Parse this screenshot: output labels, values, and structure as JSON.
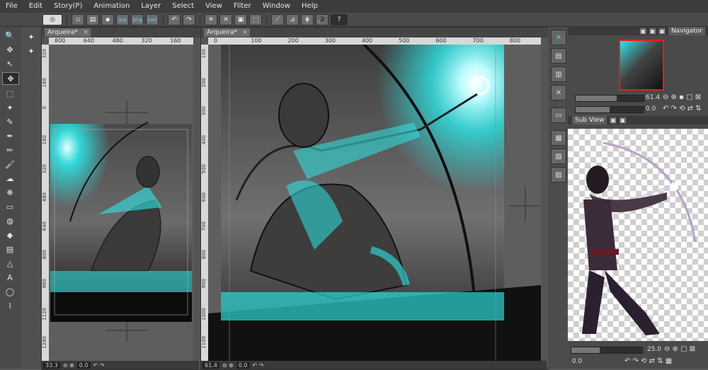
{
  "menu": [
    "File",
    "Edit",
    "Story(P)",
    "Animation",
    "Layer",
    "Select",
    "View",
    "Filter",
    "Window",
    "Help"
  ],
  "toolbar": {
    "icons": [
      "clip-logo-icon",
      "new-icon",
      "open-icon",
      "save-icon",
      "export-jpg-icon",
      "export-png-icon",
      "export-psd-icon",
      "undo-icon",
      "redo-icon",
      "loading-icon",
      "clear-icon",
      "fill-icon",
      "transform-icon",
      "ruler-snap-icon",
      "special-ruler-icon",
      "grid-icon",
      "learn-icon",
      "help-icon"
    ]
  },
  "tools": [
    "zoom-icon",
    "move-icon",
    "operation-icon",
    "move-layer-icon",
    "select-icon",
    "magic-wand-icon",
    "eyedropper-icon",
    "pen-icon",
    "pencil-icon",
    "brush-icon",
    "airbrush-icon",
    "decoration-icon",
    "eraser-icon",
    "blend-icon",
    "fill-icon",
    "gradient-icon",
    "figure-icon",
    "text-icon",
    "balloon-icon",
    "correct-line-icon"
  ],
  "canvas_left": {
    "tab": "Arqueira*",
    "ruler_h": [
      "800",
      "640",
      "480",
      "320",
      "160"
    ],
    "ruler_v": [
      "320",
      "160",
      "0",
      "160",
      "320",
      "480",
      "640",
      "800",
      "960",
      "1120",
      "1280"
    ],
    "zoom": "33.3",
    "rotation": "0.0"
  },
  "canvas_main": {
    "tab": "Arqueira*",
    "ruler_h": [
      "0",
      "100",
      "200",
      "300",
      "400",
      "500",
      "600",
      "700",
      "800"
    ],
    "ruler_v": [
      "100",
      "200",
      "300",
      "400",
      "500",
      "600",
      "700",
      "800",
      "900",
      "1000",
      "1100"
    ],
    "zoom": "61.4",
    "rotation": "0.0"
  },
  "navigator": {
    "tab": "Navigator",
    "zoom": "61.4",
    "rotation": "0.0"
  },
  "subview": {
    "tab": "Sub View",
    "zoom": "25.0",
    "rotation": "0.0"
  },
  "colors": {
    "accent": "#2ee6e6",
    "menubar": "#3d3d3d",
    "panel": "#4a4a4a"
  }
}
